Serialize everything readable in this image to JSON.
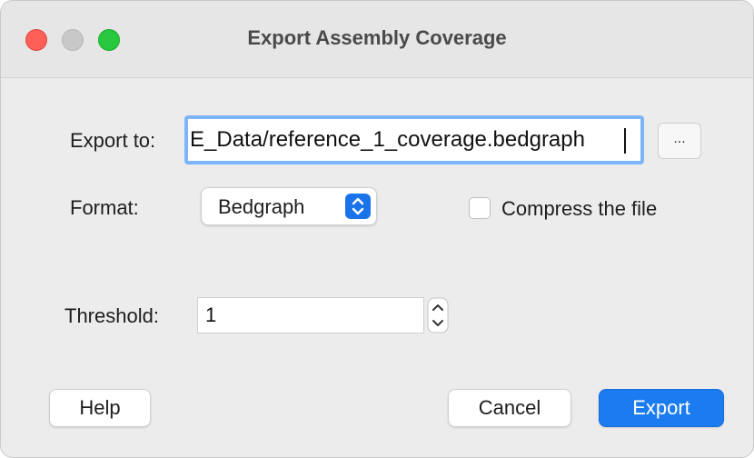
{
  "window": {
    "title": "Export Assembly Coverage"
  },
  "form": {
    "export_to_label": "Export to:",
    "export_path": "E_Data/reference_1_coverage.bedgraph",
    "browse_label": "...",
    "format_label": "Format:",
    "format_value": "Bedgraph",
    "compress_label": "Compress the file",
    "compress_checked": false,
    "threshold_label": "Threshold:",
    "threshold_value": "1"
  },
  "buttons": {
    "help": "Help",
    "cancel": "Cancel",
    "export": "Export"
  },
  "colors": {
    "accent": "#1a7cf0",
    "focus_ring": "#7eb4f8",
    "close": "#fe5f57",
    "minimize_inactive": "#c8c8c8",
    "zoom": "#28c840"
  },
  "icons": {
    "select_arrows": "chevron-up-down-icon",
    "stepper": "stepper-up-down-icon"
  }
}
